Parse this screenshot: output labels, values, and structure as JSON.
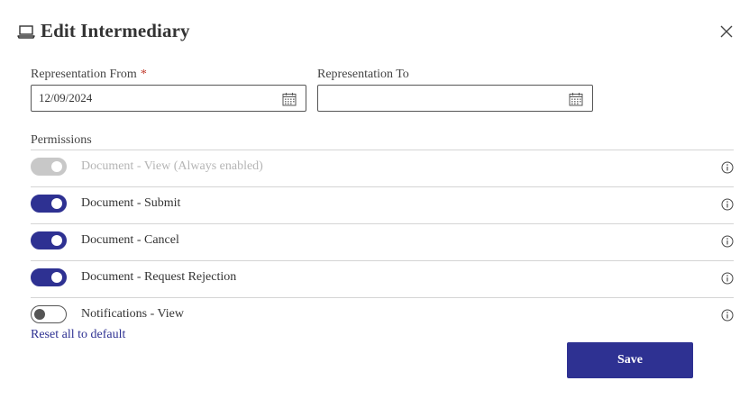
{
  "dialog": {
    "title": "Edit Intermediary",
    "title_icon": "laptop-icon",
    "close_icon": "close-icon"
  },
  "fields": {
    "from": {
      "label": "Representation From",
      "required_mark": "*",
      "value": "12/09/2024",
      "icon": "calendar-icon"
    },
    "to": {
      "label": "Representation To",
      "value": "",
      "icon": "calendar-icon"
    }
  },
  "permissions": {
    "label": "Permissions",
    "items": [
      {
        "label": "Document - View (Always enabled)",
        "state": "on",
        "disabled": true
      },
      {
        "label": "Document - Submit",
        "state": "on",
        "disabled": false
      },
      {
        "label": "Document - Cancel",
        "state": "on",
        "disabled": false
      },
      {
        "label": "Document - Request Rejection",
        "state": "on",
        "disabled": false
      },
      {
        "label": "Notifications - View",
        "state": "off",
        "disabled": false
      }
    ]
  },
  "actions": {
    "reset_label": "Reset all to default",
    "save_label": "Save"
  },
  "colors": {
    "accent": "#2e3192",
    "required": "#c0392b",
    "disabled": "#c8c8c8"
  }
}
